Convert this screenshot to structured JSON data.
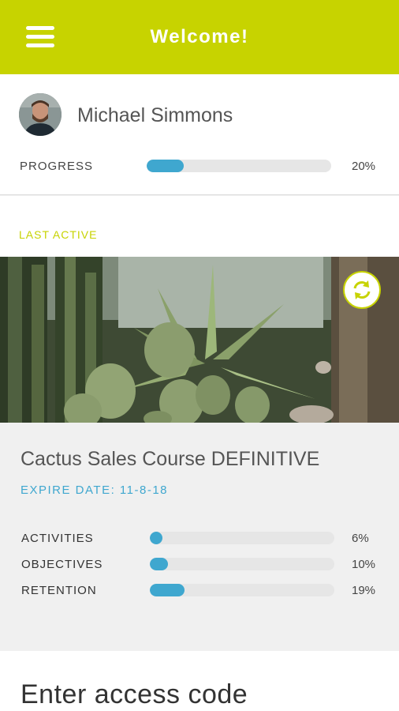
{
  "header": {
    "title": "Welcome!",
    "menu_icon": "hamburger-menu-icon",
    "bg_color": "#c7d300"
  },
  "profile": {
    "name": "Michael Simmons",
    "avatar_icon": "user-avatar",
    "progress_label": "PROGRESS",
    "progress_value": "20%",
    "progress_fraction": 0.2
  },
  "last_active": {
    "label": "LAST ACTIVE",
    "image_icon": "cactus-garden-photo",
    "refresh_icon": "refresh-icon"
  },
  "course": {
    "title": "Cactus Sales Course DEFINITIVE",
    "expire": "EXPIRE DATE: 11-8-18",
    "stats": [
      {
        "label": "ACTIVITIES",
        "value": "6%",
        "fraction": 0.06
      },
      {
        "label": "OBJECTIVES",
        "value": "10%",
        "fraction": 0.1
      },
      {
        "label": "RETENTION",
        "value": "19%",
        "fraction": 0.19
      }
    ]
  },
  "access": {
    "title": "Enter access code"
  },
  "colors": {
    "accent": "#c7d300",
    "progress": "#3fa7cf"
  }
}
